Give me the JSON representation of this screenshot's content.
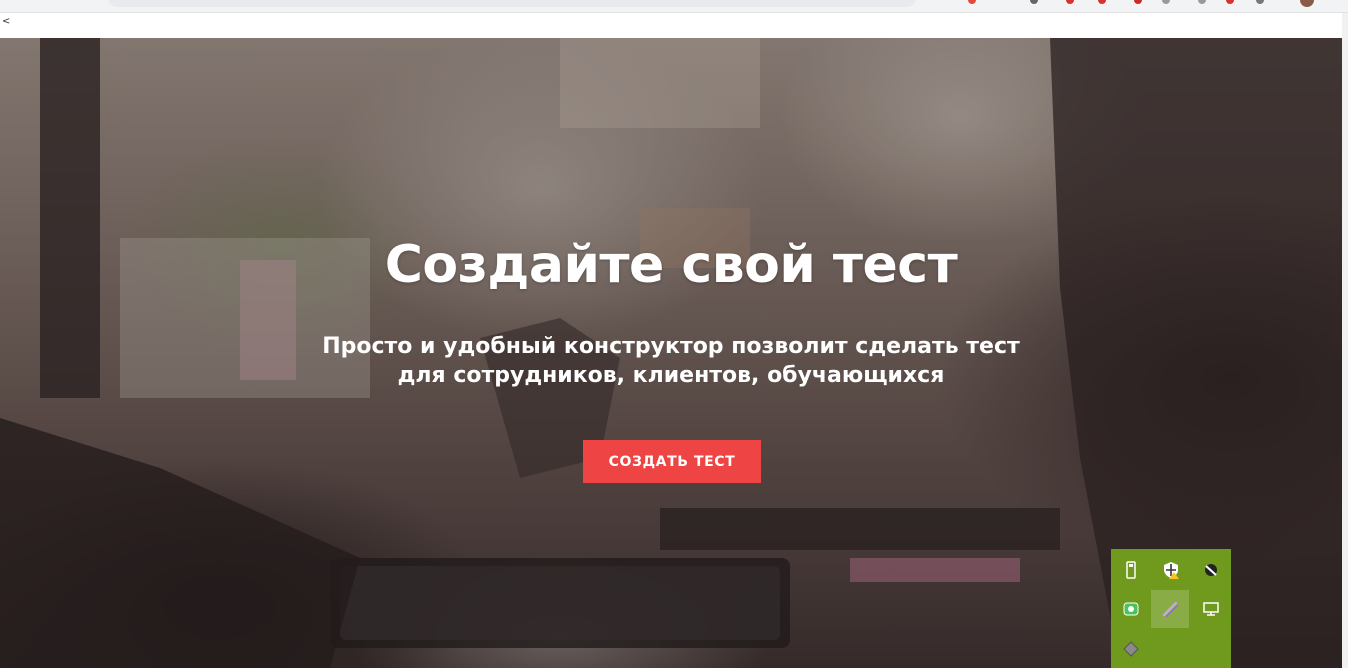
{
  "browser": {
    "back_glyph": "<"
  },
  "hero": {
    "title": "Создайте свой тест",
    "subtitle_line1": "Просто и удобный конструктор позволит сделать тест",
    "subtitle_line2": "для сотрудников, клиентов, обучающихся",
    "cta_label": "СОЗДАТЬ ТЕСТ"
  },
  "tray": {
    "icons": [
      "usb-drive-icon",
      "security-shield-icon",
      "network-icon",
      "app-green-icon",
      "pen-icon",
      "display-icon",
      "diamond-icon"
    ]
  },
  "colors": {
    "cta": "#ef4444",
    "tray_background": "#6f9a1e"
  }
}
